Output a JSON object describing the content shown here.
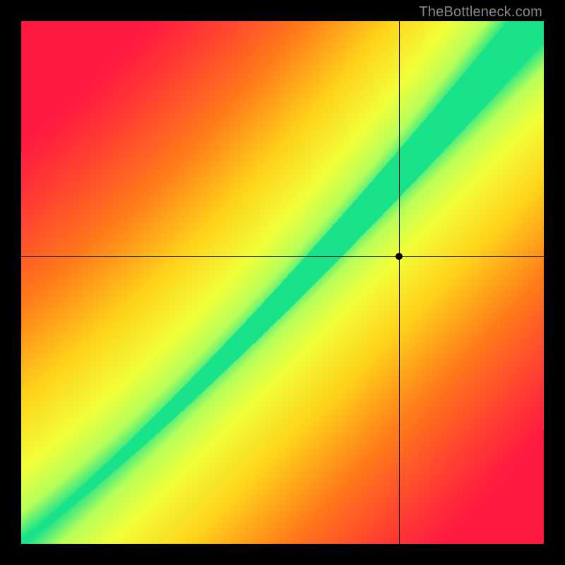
{
  "watermark": "TheBottleneck.com",
  "chart_data": {
    "type": "heatmap",
    "title": "",
    "xlabel": "",
    "ylabel": "",
    "xlim": [
      0,
      100
    ],
    "ylim": [
      0,
      100
    ],
    "crosshair": {
      "x": 72.3,
      "y": 55.0
    },
    "marker": {
      "x": 72.3,
      "y": 55.0
    },
    "corners_value": {
      "top_left": 0.0,
      "top_right": 1.0,
      "bottom_left": 1.0,
      "bottom_right": 0.0
    },
    "optimal_ridge_note": "Green band follows a slightly super-linear diagonal from bottom-left to top-right; widens toward top-right. Background grades red → orange → yellow → green based on distance to ridge.",
    "color_scale": [
      {
        "value": 0.0,
        "color": "#ff1a40"
      },
      {
        "value": 0.35,
        "color": "#ff7a1a"
      },
      {
        "value": 0.6,
        "color": "#ffd21a"
      },
      {
        "value": 0.8,
        "color": "#f2ff3a"
      },
      {
        "value": 0.92,
        "color": "#b6ff5a"
      },
      {
        "value": 1.0,
        "color": "#19e38a"
      }
    ],
    "grid_size": 200
  }
}
